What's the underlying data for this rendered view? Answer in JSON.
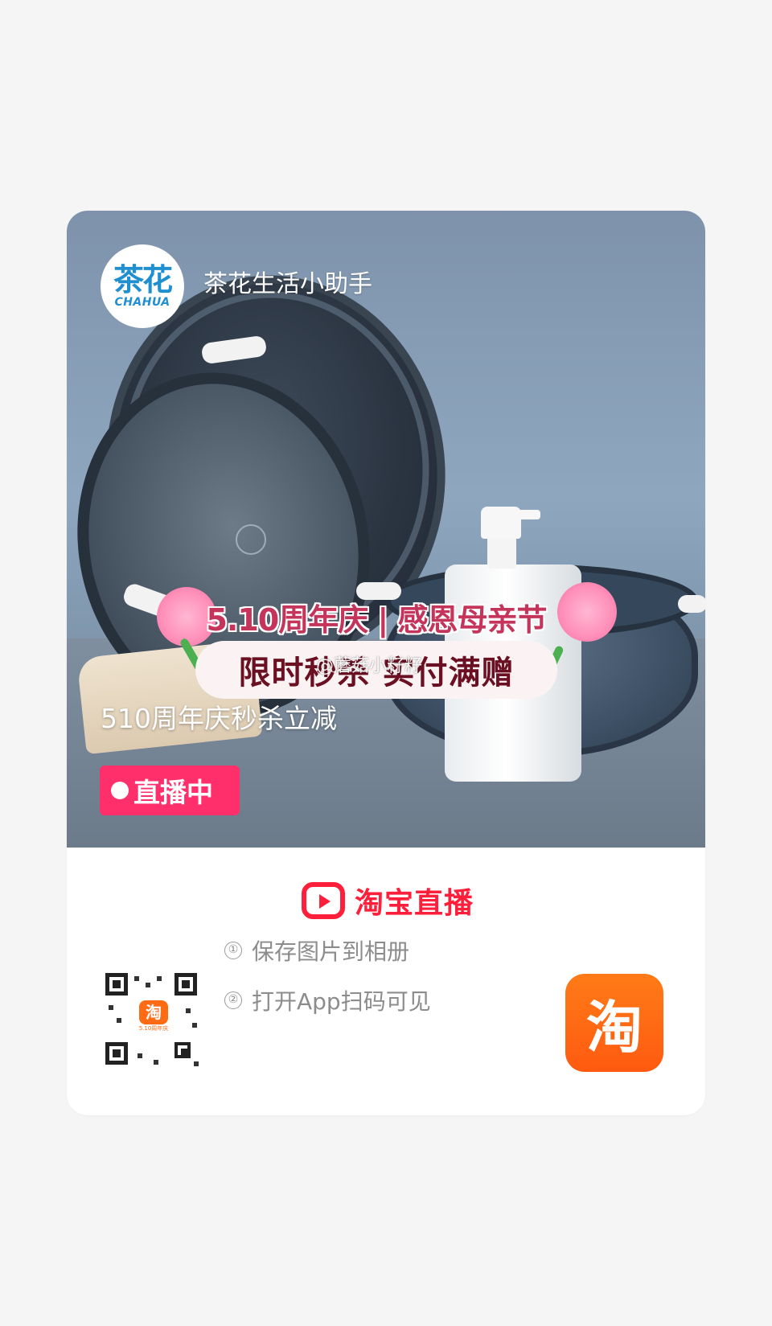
{
  "shop": {
    "avatar_logo": "茶花",
    "avatar_sub": "CHAHUA",
    "name": "茶花生活小助手"
  },
  "hero": {
    "promo_line1": "5.10周年庆 | 感恩母亲节",
    "promo_line2": "限时秒杀 实付满赠",
    "watermark": "@蘑菇小籽籽",
    "caption": "510周年庆秒杀立减",
    "live_badge": "直播中"
  },
  "footer": {
    "platform_label": "淘宝直播",
    "qr_center_label": "淘",
    "qr_center_sub": "5.10周年庆",
    "steps": [
      {
        "num": "①",
        "text": "保存图片到相册"
      },
      {
        "num": "②",
        "text": "打开App扫码可见"
      }
    ],
    "app_icon_label": "淘"
  },
  "colors": {
    "live_badge": "#ff2f6c",
    "taobao_live_red": "#ff1f3a",
    "taobao_orange": "#ff5a10",
    "brand_blue": "#1f8fd0"
  }
}
